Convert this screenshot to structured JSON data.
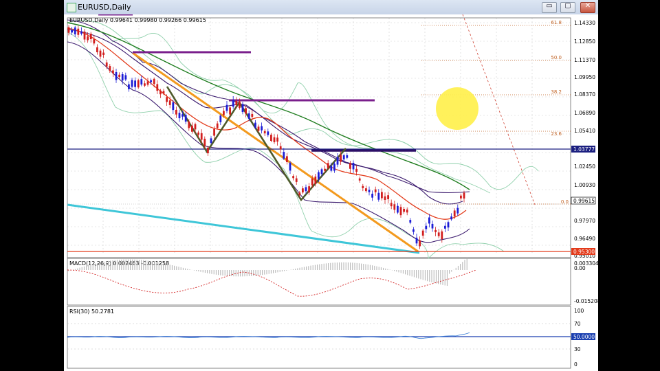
{
  "window": {
    "title": "EURUSD,Daily",
    "minimize_glyph": "▭",
    "maximize_glyph": "▢",
    "close_glyph": "✕"
  },
  "main_panel": {
    "info_label": "EURUSD,Daily  0.99641 0.99980 0.99266 0.99615",
    "price_ticks": [
      "1.14330",
      "1.12850",
      "1.11370",
      "1.09950",
      "1.08370",
      "1.06890",
      "1.05410",
      "1.02450",
      "1.00930",
      "0.97970",
      "0.96490",
      "0.95010"
    ],
    "current_price_tag": "0.99615",
    "hline_tag": "1.03777",
    "support_tag": "0.95300",
    "fib_levels": [
      "61.8",
      "50.0",
      "38.2",
      "23.6",
      "0.0"
    ],
    "colors": {
      "bull": "#1d1dd6",
      "bear": "#d21e1e",
      "ma_green": "#1f7d1f",
      "ma_red": "#e33b1b",
      "bollinger": "#8fd0ab",
      "envelope": "#3b1a6e",
      "hline": "#1b1f80",
      "purple": "#7a1f8c",
      "orange": "#f39a1e",
      "cyan": "#3ec6d8",
      "yellow": "#ffec60",
      "zigzag": "#4f5a2a"
    }
  },
  "macd_panel": {
    "label": "MACD(12,26,9) 0.002463 -0.001258",
    "ticks": [
      "0.003304",
      "0.00",
      "-0.015208"
    ]
  },
  "rsi_panel": {
    "label": "RSI(30) 50.2781",
    "ticks": [
      "100",
      "70",
      "50.0000",
      "30",
      "0"
    ]
  }
}
